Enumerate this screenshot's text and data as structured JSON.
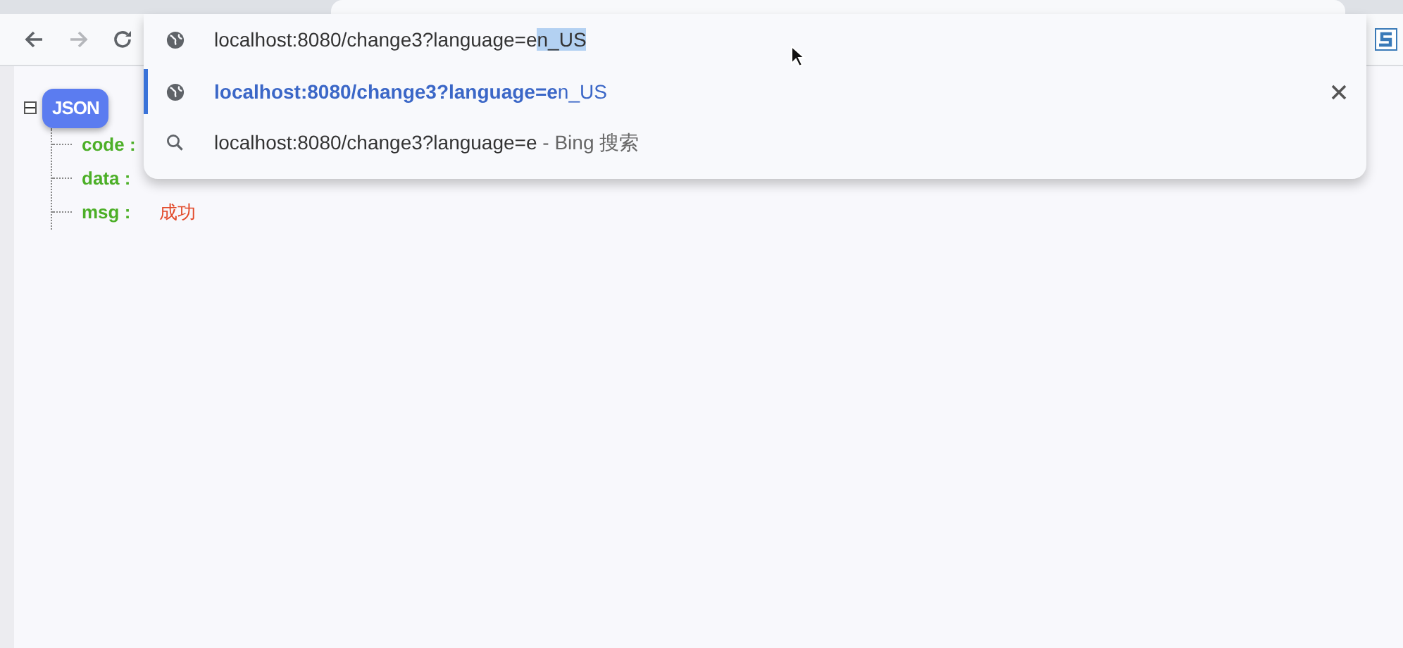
{
  "browser": {
    "nav_buttons": [
      {
        "kind": "back",
        "disabled": false
      },
      {
        "kind": "forward",
        "disabled": true
      },
      {
        "kind": "reload",
        "disabled": false
      }
    ],
    "omnibox": {
      "typed": "localhost:8080/change3?language=e",
      "autocomplete": "n_US"
    },
    "suggestions": [
      {
        "kind": "url",
        "text": "**localhost:8080/change3?language=e**n_US",
        "selected": true,
        "removable": true
      },
      {
        "kind": "search",
        "text": "localhost:8080/change3?language=e",
        "suffix": " - Bing 搜索",
        "selected": false,
        "removable": false
      }
    ]
  },
  "json_viewer": {
    "root_label": "JSON",
    "expanded": true,
    "entries": [
      {
        "key": "code :"
      },
      {
        "key": "data :"
      },
      {
        "key": "msg :",
        "value": "成功"
      }
    ]
  }
}
